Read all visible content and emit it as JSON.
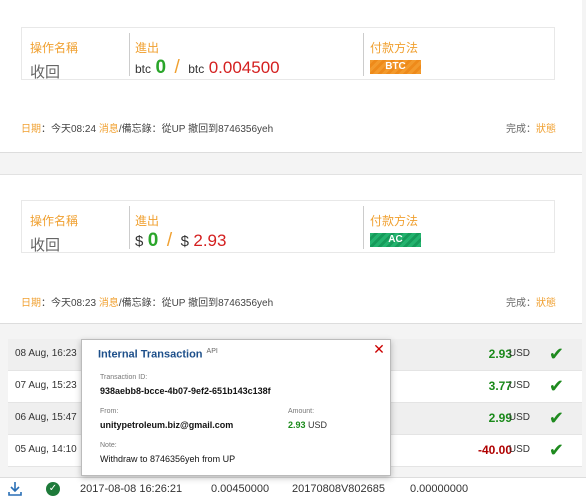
{
  "orders": [
    {
      "labels": {
        "operation": "操作名稱",
        "direction": "進出",
        "payment": "付款方法"
      },
      "operation_value": "收回",
      "currency_left": "btc",
      "zero": "0",
      "slash": "/",
      "currency_right": "btc",
      "amount": "0.004500",
      "payment_badge": "BTC",
      "meta_date_label": "日期",
      "meta_date": "：今天08:24",
      "meta_message": "消息",
      "meta_note": "/備忘錄：從UP 撤回到8746356yeh",
      "status_label": "完成",
      "status_link": "狀態"
    },
    {
      "labels": {
        "operation": "操作名稱",
        "direction": "進出",
        "payment": "付款方法"
      },
      "operation_value": "收回",
      "currency_left": "$",
      "zero": "0",
      "slash": "/",
      "currency_right": "$",
      "amount": "2.93",
      "payment_badge": "AC",
      "meta_date_label": "日期",
      "meta_date": "：今天08:23",
      "meta_message": "消息",
      "meta_note": "/備忘錄：從UP 撤回到8746356yeh",
      "status_label": "完成",
      "status_link": "狀態"
    }
  ],
  "transactions": [
    {
      "date": "08 Aug, 16:23",
      "amount": "2.93",
      "unit": "USD",
      "sign": "pos"
    },
    {
      "date": "07 Aug, 15:23",
      "amount": "3.77",
      "unit": "USD",
      "sign": "pos"
    },
    {
      "date": "06 Aug, 15:47",
      "amount": "2.99",
      "unit": "USD",
      "sign": "pos"
    },
    {
      "date": "05 Aug, 14:10",
      "amount": "-40.00",
      "unit": "USD",
      "sign": "neg"
    }
  ],
  "popup": {
    "title": "Internal Transaction",
    "api": "API",
    "txid_label": "Transaction ID:",
    "txid": "938aebb8-bcce-4b07-9ef2-651b143c138f",
    "from_label": "From:",
    "from": "unitypetroleum.biz@gmail.com",
    "amount_label": "Amount:",
    "amount": "2.93",
    "amount_unit": "USD",
    "note_label": "Note:",
    "note": "Withdraw to 8746356yeh from UP",
    "close": "✕"
  },
  "bottom_row": {
    "datetime": "2017-08-08 16:26:21",
    "amount": "0.00450000",
    "reference": "20170808V802685",
    "balance": "0.00000000"
  },
  "colors": {
    "accent_orange": "#f0a030",
    "positive_green": "#2aa52a",
    "negative_red": "#d42020",
    "link_blue": "#1d4f8a"
  }
}
